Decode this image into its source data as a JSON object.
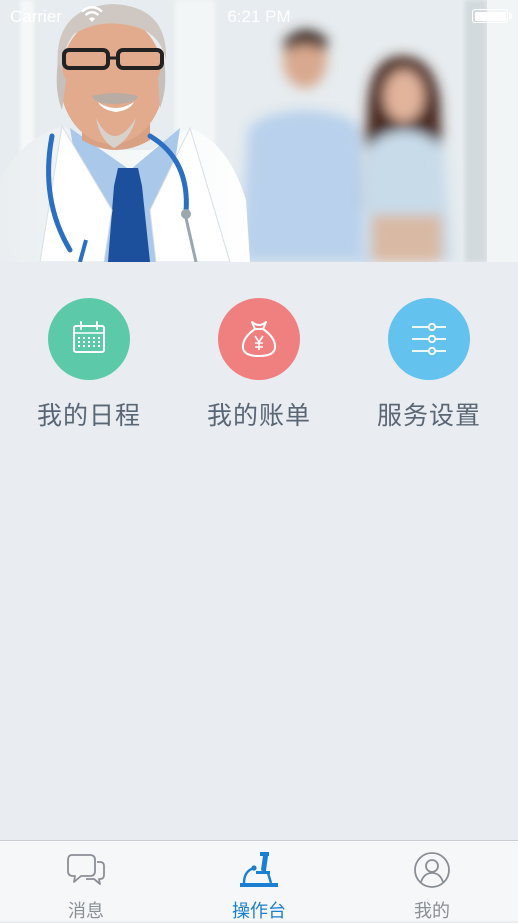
{
  "status_bar": {
    "carrier": "Carrier",
    "time": "6:21 PM"
  },
  "banner": {
    "image": "doctor-with-patients-photo"
  },
  "menu": {
    "items": [
      {
        "label": "我的日程",
        "icon": "calendar-icon",
        "color": "#5ccaa8"
      },
      {
        "label": "我的账单",
        "icon": "money-bag-icon",
        "color": "#f07f80"
      },
      {
        "label": "服务设置",
        "icon": "settings-sliders-icon",
        "color": "#63c2ee"
      }
    ]
  },
  "tabbar": {
    "tabs": [
      {
        "label": "消息",
        "icon": "chat-bubbles-icon",
        "active": false
      },
      {
        "label": "操作台",
        "icon": "microscope-icon",
        "active": true
      },
      {
        "label": "我的",
        "icon": "user-profile-icon",
        "active": false
      }
    ],
    "active_color": "#1a7fd0",
    "inactive_color": "#8a8f95"
  }
}
